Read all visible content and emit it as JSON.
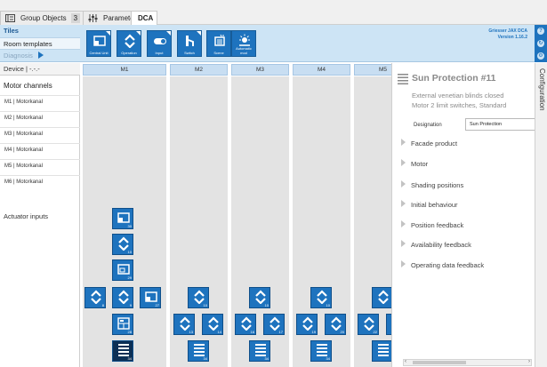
{
  "tabs": [
    {
      "label": "Group Objects",
      "count": "3"
    },
    {
      "label": "Parameters"
    },
    {
      "label": "DCA"
    }
  ],
  "ribbon": {
    "tiles_header": "Tiles",
    "room_templates": "Room templates",
    "diagnosis": "Diagnosis",
    "buttons": [
      {
        "label": "Central Unit",
        "icon": "central-unit-icon"
      },
      {
        "label": "Operation",
        "icon": "operation-icon"
      },
      {
        "label": "Input",
        "icon": "input-icon"
      },
      {
        "label": "Switch",
        "icon": "switch-icon"
      },
      {
        "label": "Scene",
        "icon": "scene-icon"
      },
      {
        "label": "Automatic mod",
        "icon": "automatic-mode-icon"
      }
    ],
    "brand_name": "Griesser JAX DCA",
    "version": "Version 1.16.2"
  },
  "leftpane": {
    "device": "Device | -.-.-",
    "motor_channels_header": "Motor channels",
    "channels": [
      "M1 | Motorkanal",
      "M2 | Motorkanal",
      "M3 | Motorkanal",
      "M4 | Motorkanal",
      "M5 | Motorkanal",
      "M6 | Motorkanal"
    ],
    "actuator_inputs": "Actuator inputs"
  },
  "grid": {
    "columns": [
      "M1",
      "M2",
      "M3",
      "M4",
      "M5"
    ],
    "tile_numbers": {
      "m1_a": "30",
      "m1_b": "10",
      "m1_c": "29",
      "m1_r1": "8",
      "m1_r2": "9",
      "m1_r3": "27",
      "m1_d": "28",
      "m1_e": "34",
      "m2_a": "10",
      "m2_l": "13",
      "m2_r": "14",
      "m2_e": "34",
      "m3_a": "10",
      "m3_l": "16",
      "m3_r": "17",
      "m3_e": "34",
      "m4_a": "10",
      "m4_l": "19",
      "m4_r": "20",
      "m4_e": "34",
      "m5_l": "22"
    }
  },
  "rightpane": {
    "title": "Sun Protection #11",
    "subtitle1": "External venetian blinds closed",
    "subtitle2": "Motor 2 limit switches, Standard",
    "designation_label": "Designation",
    "designation_value": "Sun Protection",
    "sections": [
      "Facade product",
      "Motor",
      "Shading positions",
      "Initial behaviour",
      "Position feedback",
      "Availability feedback",
      "Operating data feedback"
    ]
  },
  "config_tab": "Configuration",
  "colors": {
    "accent": "#1e73be",
    "ribbon_bg": "#cde4f5",
    "dark_tile": "#0c2f55"
  }
}
